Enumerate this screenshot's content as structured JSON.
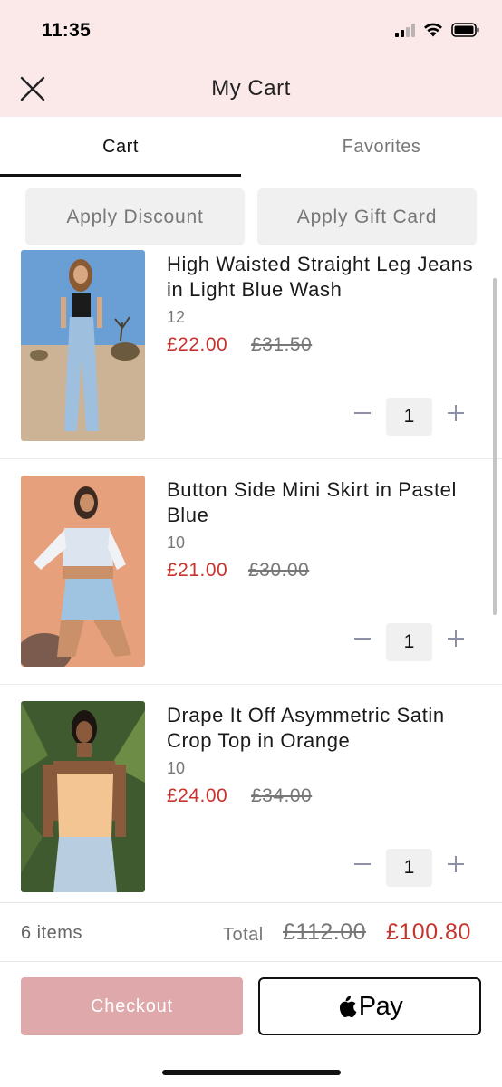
{
  "status_bar": {
    "time": "11:35"
  },
  "header": {
    "title": "My Cart",
    "close_icon": "close-icon"
  },
  "tabs": [
    {
      "label": "Cart",
      "active": true
    },
    {
      "label": "Favorites",
      "active": false
    }
  ],
  "actions": {
    "apply_discount": "Apply Discount",
    "apply_gift_card": "Apply Gift Card"
  },
  "items": [
    {
      "title": "High Waisted Straight Leg Jeans in Light Blue Wash",
      "size": "12",
      "price": "£22.00",
      "was_price": "£31.50",
      "quantity": "1"
    },
    {
      "title": "Button Side Mini Skirt in Pastel Blue",
      "size": "10",
      "price": "£21.00",
      "was_price": "£30.00",
      "quantity": "1"
    },
    {
      "title": "Drape It Off Asymmetric Satin Crop Top in Orange",
      "size": "10",
      "price": "£24.00",
      "was_price": "£34.00",
      "quantity": "1"
    }
  ],
  "summary": {
    "items_count": "6 items",
    "total_label": "Total",
    "total_was": "£112.00",
    "total_now": "£100.80"
  },
  "buttons": {
    "checkout": "Checkout",
    "apple_pay": "Pay"
  },
  "colors": {
    "header_bg": "#fbe9e9",
    "sale_red": "#c8342d",
    "checkout_pink": "#dfa9ab"
  }
}
